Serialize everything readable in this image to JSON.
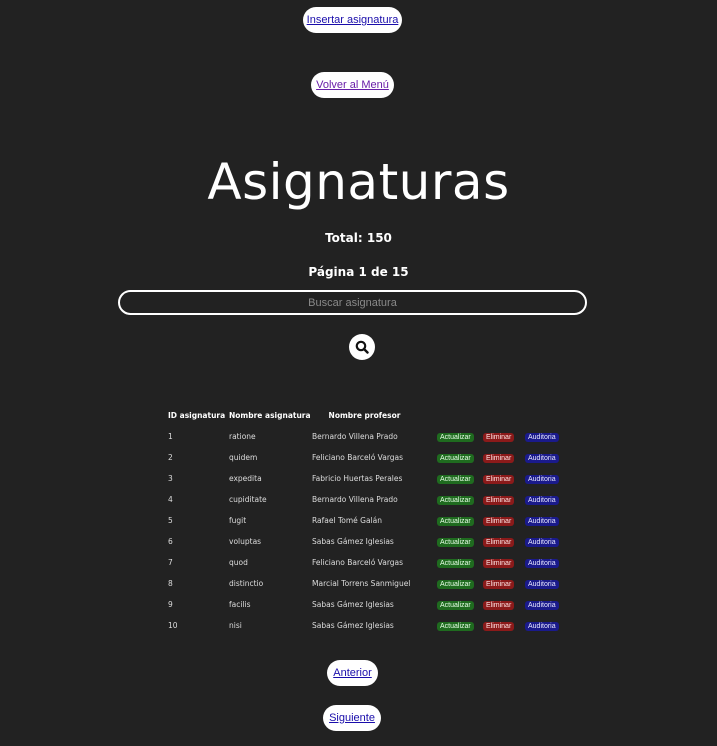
{
  "nav": {
    "insert_label": "Insertar asignatura",
    "back_label": "Volver al Menú"
  },
  "header": {
    "title": "Asignaturas",
    "total": "Total: 150",
    "pagina": "Página 1 de 15"
  },
  "search": {
    "placeholder": "Buscar asignatura",
    "value": ""
  },
  "table": {
    "headers": [
      "ID asignatura",
      "Nombre asignatura",
      "Nombre profesor"
    ],
    "actions": {
      "update": "Actualizar",
      "delete": "Eliminar",
      "audit": "Auditoria"
    },
    "rows": [
      {
        "id": "1",
        "name": "ratione",
        "profesor": "Bernardo Villena Prado"
      },
      {
        "id": "2",
        "name": "quidem",
        "profesor": "Feliciano Barceló Vargas"
      },
      {
        "id": "3",
        "name": "expedita",
        "profesor": "Fabricio Huertas Perales"
      },
      {
        "id": "4",
        "name": "cupiditate",
        "profesor": "Bernardo Villena Prado"
      },
      {
        "id": "5",
        "name": "fugit",
        "profesor": "Rafael Tomé Galán"
      },
      {
        "id": "6",
        "name": "voluptas",
        "profesor": "Sabas Gámez Iglesias"
      },
      {
        "id": "7",
        "name": "quod",
        "profesor": "Feliciano Barceló Vargas"
      },
      {
        "id": "8",
        "name": "distinctio",
        "profesor": "Marcial Torrens Sanmiguel"
      },
      {
        "id": "9",
        "name": "facilis",
        "profesor": "Sabas Gámez Iglesias"
      },
      {
        "id": "10",
        "name": "nisi",
        "profesor": "Sabas Gámez Iglesias"
      }
    ]
  },
  "pagination": {
    "prev_label": "Anterior",
    "next_label": "Siguiente"
  },
  "colors": {
    "background": "#222222",
    "update": "#1f6b1f",
    "delete": "#8b1a1a",
    "audit": "#1a1a8b"
  },
  "icons": {
    "search": "search-icon"
  }
}
